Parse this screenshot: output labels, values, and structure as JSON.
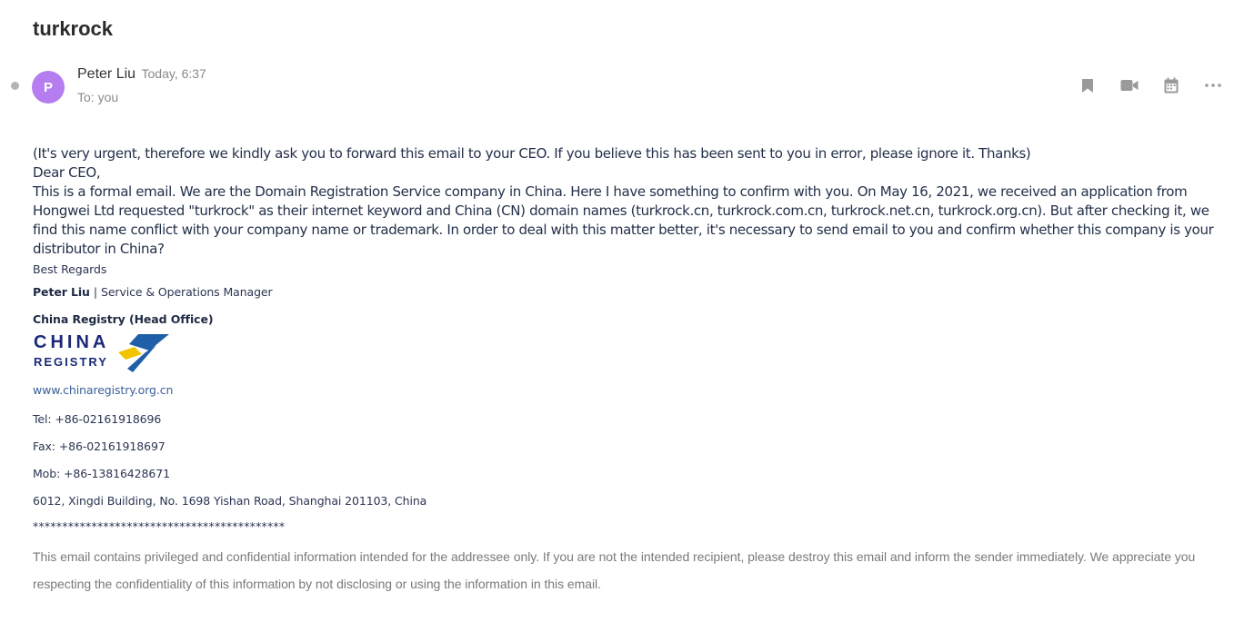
{
  "subject": "turkrock",
  "sender": {
    "avatar_letter": "P",
    "name": "Peter Liu",
    "time": "Today, 6:37",
    "to": "To: you"
  },
  "actions": {
    "bookmark": "bookmark-icon",
    "video": "video-icon",
    "calendar": "calendar-icon",
    "more": "more-icon"
  },
  "body": {
    "line1": "(It's very urgent, therefore we kindly ask you to forward this email to your CEO. If you believe this has been sent to you in error, please ignore it. Thanks)",
    "greeting": "Dear CEO,",
    "paragraph": "This is a formal email. We are the Domain Registration Service company in China. Here I have something to confirm with you. On May 16, 2021, we received an application from Hongwei Ltd requested \"turkrock\" as their internet keyword and China (CN) domain names (turkrock.cn, turkrock.com.cn, turkrock.net.cn, turkrock.org.cn). But after checking it, we find this name conflict with your company name or trademark. In order to deal with this matter better, it's necessary to send email to you and confirm whether this company is your distributor in China?"
  },
  "signature": {
    "regards": "Best Regards",
    "name": "Peter Liu",
    "separator": "|",
    "title": "Service & Operations Manager",
    "office": "China Registry (Head Office)",
    "logo_line1": "CHINA",
    "logo_line2": "REGISTRY",
    "website": "www.chinaregistry.org.cn",
    "tel": "Tel: +86-02161918696",
    "fax": "Fax: +86-02161918697",
    "mob": "Mob: +86-13816428671",
    "address": "6012, Xingdi Building, No. 1698 Yishan Road, Shanghai 201103, China",
    "stars": "*******************************************"
  },
  "disclaimer": "This email contains privileged and confidential information intended for the addressee only. If you are not the intended recipient, please destroy this email and inform the sender immediately. We appreciate you respecting the confidentiality of this information by not disclosing or using the information in this email.",
  "colors": {
    "avatar": "#b57df0",
    "icon": "#9a9a9a",
    "logo_blue": "#1f5fa8",
    "logo_yellow": "#f2c500"
  }
}
